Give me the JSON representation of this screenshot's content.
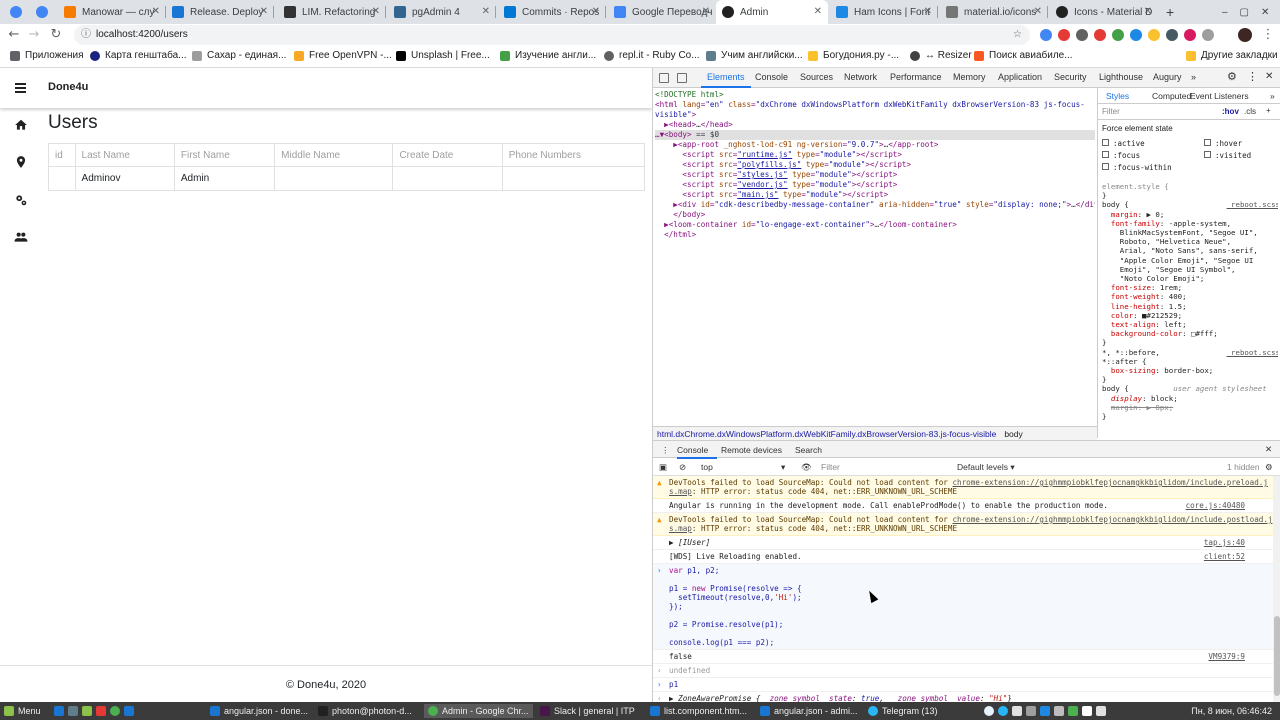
{
  "browser": {
    "tabs": [
      {
        "label": "",
        "color": "#4285f4"
      },
      {
        "label": "",
        "color": "#4285f4"
      },
      {
        "label": "Manowar — слу",
        "color": "#f57c00"
      },
      {
        "label": "Release. Deploy",
        "color": "#1976d2"
      },
      {
        "label": "LIM. Refactoring",
        "color": "#333333"
      },
      {
        "label": "pgAdmin 4",
        "color": "#326690"
      },
      {
        "label": "Commits · Repos",
        "color": "#0078d4"
      },
      {
        "label": "Google Переводч",
        "color": "#4285f4"
      },
      {
        "label": "Admin",
        "color": "#222222"
      },
      {
        "label": "Ham Icons | Font",
        "color": "#1e88e5"
      },
      {
        "label": "material.io/icons",
        "color": "#757575"
      },
      {
        "label": "Icons - Material D",
        "color": "#212121"
      }
    ],
    "new_tab": "+",
    "url": "localhost:4200/users",
    "bookmarks": [
      {
        "label": "Приложения",
        "color": "#5f6368"
      },
      {
        "label": "Карта генштаба...",
        "color": "#1a237e"
      },
      {
        "label": "Сахар - единая...",
        "color": "#9e9e9e"
      },
      {
        "label": "Free OpenVPN -...",
        "color": "#f9a825"
      },
      {
        "label": "Unsplash | Free...",
        "color": "#000000"
      },
      {
        "label": "Изучение англи...",
        "color": "#43a047"
      },
      {
        "label": "repl.it - Ruby Co...",
        "color": "#616161"
      },
      {
        "label": "Учим английски...",
        "color": "#607d8b"
      },
      {
        "label": "Богудония.ру -...",
        "color": "#fbc02d"
      },
      {
        "label": "↔ Resizer",
        "color": "#424242"
      },
      {
        "label": "Поиск авиабиле...",
        "color": "#ff5722"
      }
    ],
    "other_bookmarks": "Другие закладки"
  },
  "app": {
    "title": "Done4u",
    "page_title": "Users",
    "table": {
      "columns": [
        "id",
        "Last Name",
        "First Name",
        "Middle Name",
        "Create Date",
        "Phone Numbers"
      ],
      "rows": [
        [
          "",
          "Adminov",
          "Admin",
          "",
          "",
          ""
        ]
      ]
    },
    "footer": "© Done4u, 2020"
  },
  "devtools": {
    "tabs": [
      "Elements",
      "Console",
      "Sources",
      "Network",
      "Performance",
      "Memory",
      "Application",
      "Security",
      "Lighthouse",
      "Augury"
    ],
    "more": "»",
    "styles_tabs": [
      "Styles",
      "Computed",
      "Event Listeners"
    ],
    "styles_filter": "Filter",
    "hov": ":hov",
    "cls": ".cls",
    "force_state_title": "Force element state",
    "states": [
      ":active",
      ":hover",
      ":focus",
      ":visited",
      ":focus-within"
    ],
    "breadcrumb_1": "html.dxChrome.dxWindowsPlatform.dxWebKitFamily.dxBrowserVersion-83.js-focus-visible",
    "breadcrumb_2": "body",
    "drawer_tabs": [
      "Console",
      "Remote devices",
      "Search"
    ],
    "context": "top",
    "console_filter": "Filter",
    "levels": "Default levels ▾",
    "hidden": "1 hidden"
  },
  "taskbar": {
    "items": [
      {
        "label": "Menu",
        "color": "#8bc34a"
      },
      {
        "label": "angular.json - done...",
        "color": "#1976d2"
      },
      {
        "label": "photon@photon-d...",
        "color": "#212121"
      },
      {
        "label": "Admin - Google Chr...",
        "color": "#4caf50"
      },
      {
        "label": "Slack | general | ITP",
        "color": "#4a154b"
      },
      {
        "label": "list.component.htm...",
        "color": "#1976d2"
      },
      {
        "label": "angular.json - admi...",
        "color": "#1976d2"
      },
      {
        "label": "Telegram (13)",
        "color": "#29b6f6"
      }
    ],
    "clock": "Пн, 8 июн, 06:46:42"
  }
}
